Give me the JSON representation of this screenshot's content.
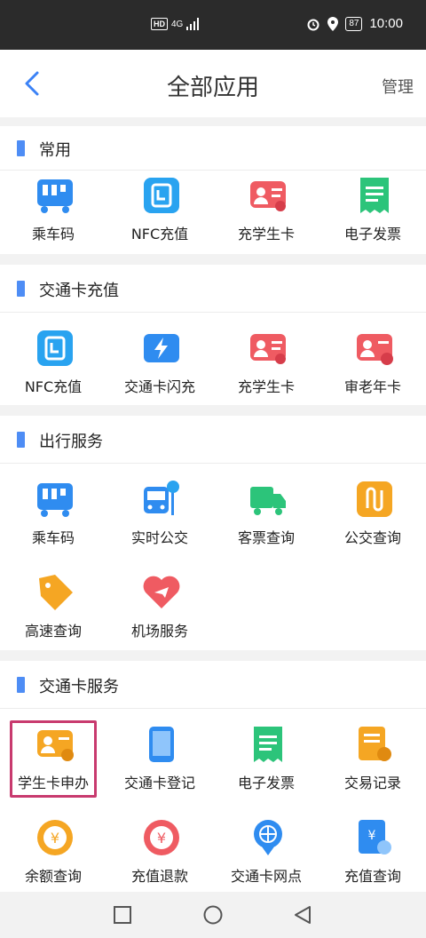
{
  "status_bar": {
    "network": "HD",
    "signal": "4G",
    "battery": "87",
    "time": "10:00"
  },
  "header": {
    "title": "全部应用",
    "manage": "管理"
  },
  "sections": [
    {
      "title": "常用",
      "items": [
        "乘车码",
        "NFC充值",
        "充学生卡",
        "电子发票"
      ]
    },
    {
      "title": "交通卡充值",
      "items": [
        "NFC充值",
        "交通卡闪充",
        "充学生卡",
        "审老年卡"
      ]
    },
    {
      "title": "出行服务",
      "items": [
        "乘车码",
        "实时公交",
        "客票查询",
        "公交查询",
        "高速查询",
        "机场服务"
      ]
    },
    {
      "title": "交通卡服务",
      "items": [
        "学生卡申办",
        "交通卡登记",
        "电子发票",
        "交易记录",
        "余额查询",
        "充值退款",
        "交通卡网点",
        "充值查询"
      ]
    }
  ],
  "colors": {
    "accent": "#4e8df5",
    "highlight": "#c83a6e"
  }
}
